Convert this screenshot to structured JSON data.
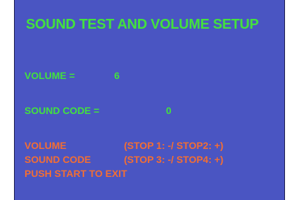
{
  "screen": {
    "title": "SOUND TEST AND VOLUME SETUP",
    "volume_label": "VOLUME =",
    "volume_value": "6",
    "sound_code_label": "SOUND CODE =",
    "sound_code_value": "0",
    "help": [
      {
        "label": "VOLUME",
        "keys": "(STOP 1: -/ STOP2: +)"
      },
      {
        "label": "SOUND CODE",
        "keys": "(STOP 3: -/ STOP4: +)"
      }
    ],
    "exit_text": "PUSH START TO EXIT"
  },
  "colors": {
    "background": "#4a55c2",
    "primary_text": "#43e23d",
    "help_text": "#f36e33"
  }
}
